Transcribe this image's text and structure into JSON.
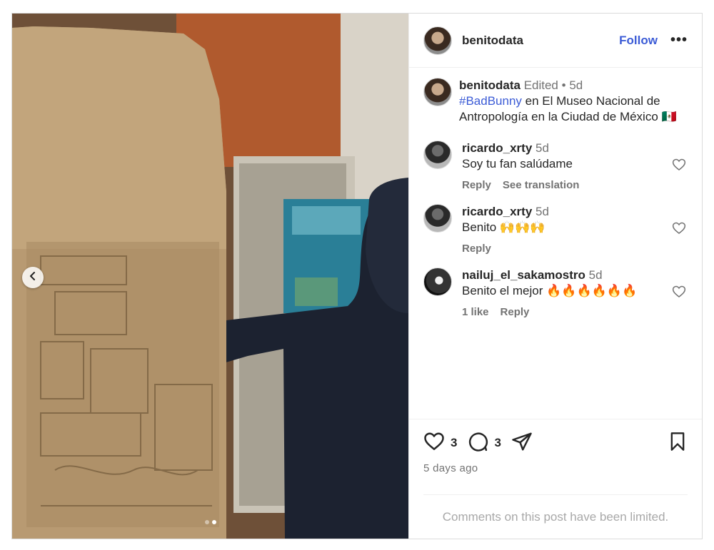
{
  "header": {
    "username": "benitodata",
    "follow_label": "Follow",
    "more_icon": "more-horizontal-icon"
  },
  "caption": {
    "username": "benitodata",
    "edited": "Edited",
    "separator": "•",
    "time": "5d",
    "hashtag": "#BadBunny",
    "text": " en El Museo Nacional de Antropología en la Ciudad de México 🇲🇽"
  },
  "comments": [
    {
      "username": "ricardo_xrty",
      "time": "5d",
      "text": "Soy tu fan salúdame",
      "likes": "",
      "reply": "Reply",
      "translate": "See translation"
    },
    {
      "username": "ricardo_xrty",
      "time": "5d",
      "text": "Benito 🙌🙌🙌",
      "likes": "",
      "reply": "Reply",
      "translate": ""
    },
    {
      "username": "nailuj_el_sakamostro",
      "time": "5d",
      "text": "Benito el mejor 🔥🔥🔥🔥🔥🔥",
      "likes": "1 like",
      "reply": "Reply",
      "translate": ""
    }
  ],
  "actions": {
    "like_count": "3",
    "comment_count": "3",
    "posted": "5 days ago",
    "limited_notice": "Comments on this post have been limited."
  },
  "carousel": {
    "total_slides": 2,
    "active_slide": 2
  },
  "colors": {
    "link": "#3b5bd6",
    "muted": "#737373",
    "border": "#dbdbdb"
  }
}
